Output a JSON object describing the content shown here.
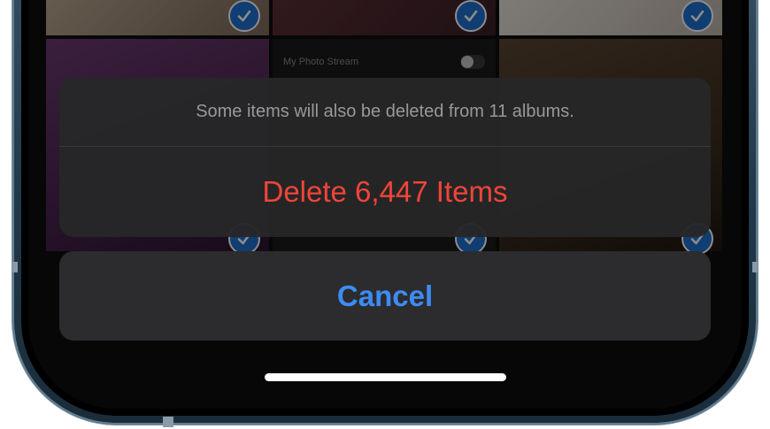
{
  "photos_background": {
    "stream_row_label": "My Photo Stream",
    "stream_toggle_on": false,
    "accent_color": "#1e6fd0"
  },
  "action_sheet": {
    "message": "Some items will also be deleted from 11 albums.",
    "destructive_label": "Delete 6,447 Items",
    "destructive_color": "#f0453a"
  },
  "cancel": {
    "label": "Cancel",
    "color": "#3d8cf5"
  },
  "icons": {
    "selection": "checkmark-circle-icon"
  }
}
